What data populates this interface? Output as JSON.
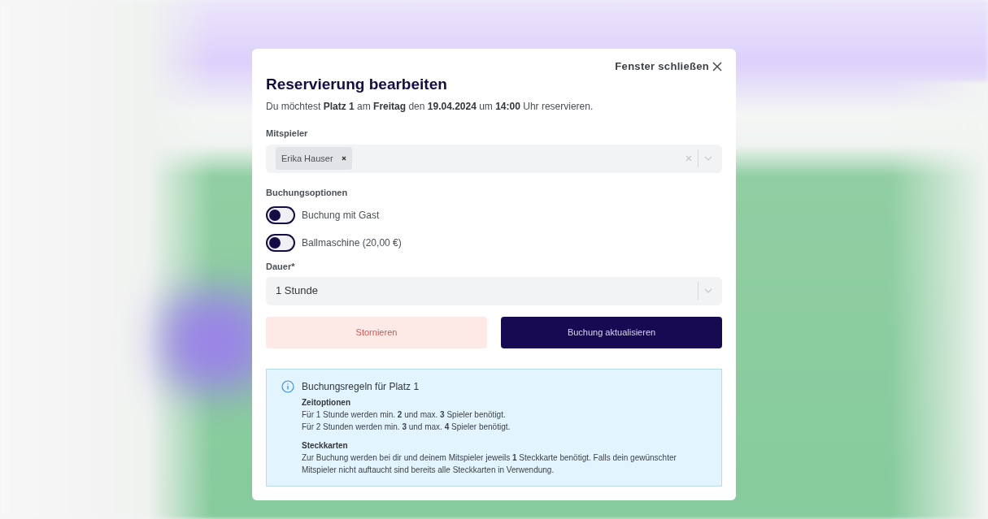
{
  "dialog": {
    "close_label": "Fenster schließen",
    "title": "Reservierung bearbeiten",
    "intro": "Du möchtest **Platz 1** am **Freitag** den **19.04.2024** um **14:00** Uhr reservieren.",
    "players": {
      "label": "Mitspieler",
      "tags": [
        "Erika Hauser"
      ]
    },
    "options": {
      "label": "Buchungsoptionen",
      "items": [
        {
          "label": "Buchung mit Gast",
          "on": false
        },
        {
          "label": "Ballmaschine (20,00 €)",
          "on": false
        }
      ]
    },
    "duration": {
      "label": "Dauer*",
      "value": "1 Stunde"
    },
    "buttons": {
      "cancel": "Stornieren",
      "submit": "Buchung aktualisieren"
    },
    "rules": {
      "title": "Buchungsregeln für Platz 1",
      "sections": [
        {
          "heading": "Zeitoptionen",
          "lines": [
            "Für 1 Stunde werden min. **2** und max. **3** Spieler benötigt.",
            "Für 2 Stunden werden min. **3** und max. **4** Spieler benötigt."
          ]
        },
        {
          "heading": "Steckkarten",
          "lines": [
            "Zur Buchung werden bei dir und deinem Mitspieler jeweils **1** Steckkarte benötigt. Falls dein gewünschter Mitspieler nicht auftaucht sind bereits alle Steckkarten in Verwendung."
          ]
        }
      ]
    }
  }
}
